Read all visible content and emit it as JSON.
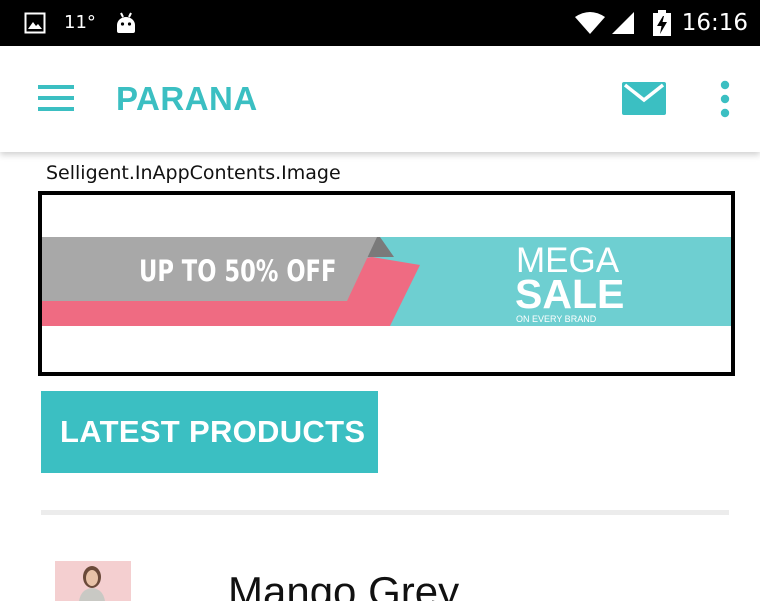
{
  "status_bar": {
    "temperature": "11°",
    "time": "16:16"
  },
  "app_bar": {
    "title": "PARANA",
    "accent_color": "#3bbfc2"
  },
  "in_app_content": {
    "label": "Selligent.InAppContents.Image",
    "banner": {
      "discount_text": "UP TO 50% OFF",
      "mega_text": "MEGA",
      "sale_text": "SALE",
      "sub_text": "ON EVERY BRAND",
      "colors": {
        "teal": "#6ecfd1",
        "gray": "#a8a8a8",
        "dark_gray": "#7a7a7a",
        "pink": "#ef6b82"
      }
    }
  },
  "latest_products": {
    "button_label": "LATEST PRODUCTS"
  },
  "products": [
    {
      "name": "Mango Grey"
    }
  ],
  "icons": {
    "status_left": [
      "image-icon",
      "android-icon"
    ],
    "status_right": [
      "wifi-icon",
      "cell-signal-icon",
      "battery-charging-icon"
    ],
    "app_bar": [
      "menu-icon",
      "mail-icon",
      "more-vert-icon"
    ]
  }
}
